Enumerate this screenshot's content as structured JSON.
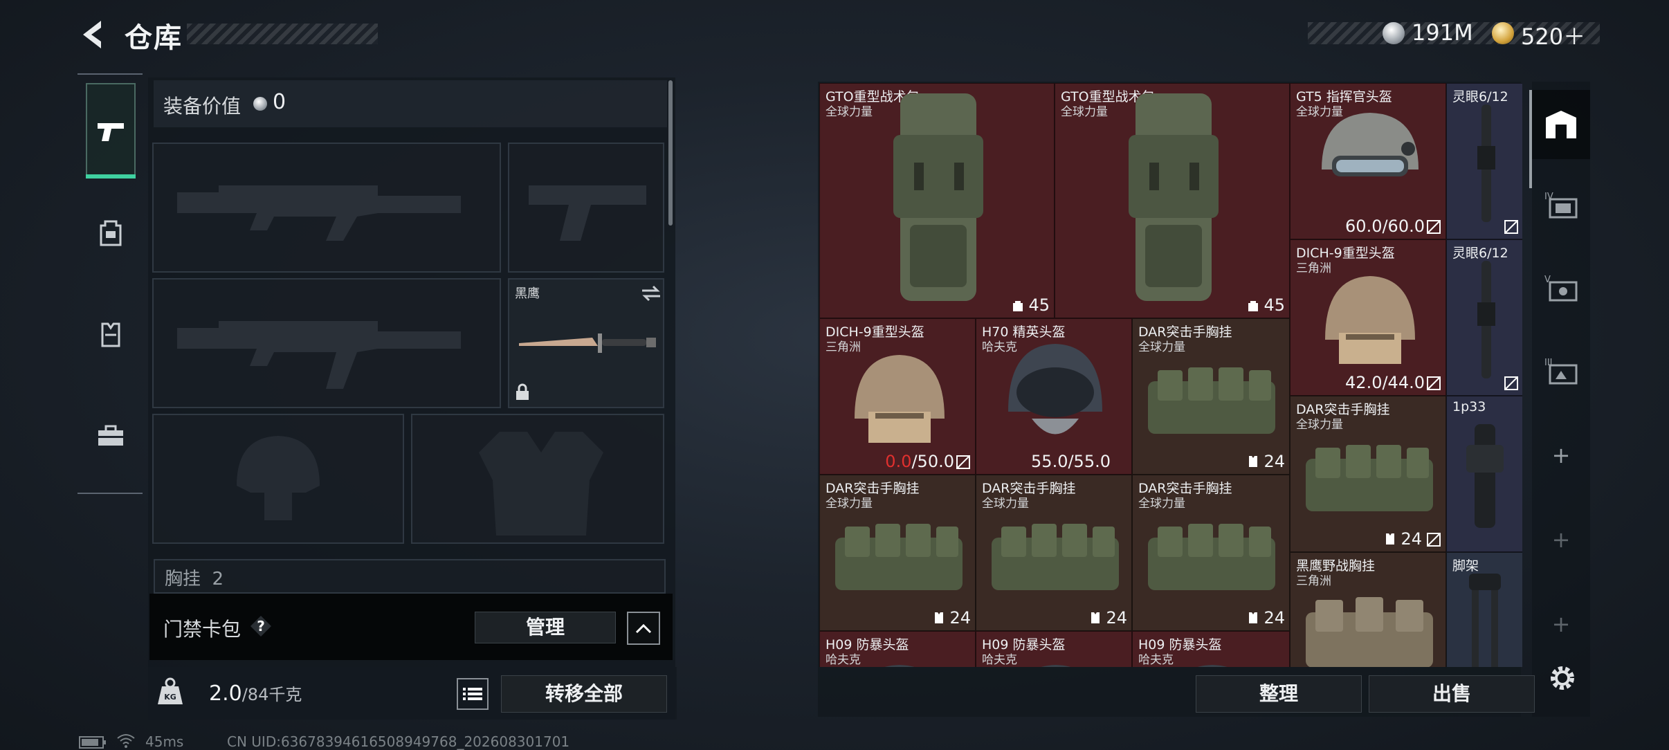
{
  "header": {
    "title": "仓库",
    "silver": "191M",
    "gold": "520＋"
  },
  "equipment": {
    "value_label": "装备价值",
    "value": "0",
    "knife_name": "黑鹰",
    "partial_label": "胸挂",
    "partial_count": "2",
    "keycard_label": "门禁卡包",
    "help": "?",
    "manage_label": "管理",
    "weight_current": "2.0",
    "weight_max": "/84千克",
    "transfer_label": "转移全部"
  },
  "status": {
    "ping": "45ms",
    "uid": "CN UID:636783946165089497​68_202608301701"
  },
  "stash": {
    "items": [
      {
        "name": "GTO重型战术包",
        "sub": "全球力量",
        "count": "45"
      },
      {
        "name": "GTO重型战术包",
        "sub": "全球力量",
        "count": "45"
      },
      {
        "name": "GT5 指挥官头盔",
        "sub": "全球力量",
        "dur": "60.0/60.0"
      },
      {
        "name": "灵眼6/12"
      },
      {
        "name": "DICH-9重型头盔",
        "sub": "三角洲",
        "dur": "42.0/44.0"
      },
      {
        "name": "灵眼6/12"
      },
      {
        "name": "DICH-9重型头盔",
        "sub": "三角洲",
        "dur_dmg": "0.0",
        "dur_rest": "/50.0"
      },
      {
        "name": "H70 精英头盔",
        "sub": "哈夫克",
        "dur": "55.0/55.0"
      },
      {
        "name": "DAR突击手胸挂",
        "sub": "全球力量",
        "count": "24"
      },
      {
        "name": "DAR突击手胸挂",
        "sub": "全球力量",
        "count": "24"
      },
      {
        "name": "1p33"
      },
      {
        "name": "DAR突击手胸挂",
        "sub": "全球力量",
        "count": "24"
      },
      {
        "name": "DAR突击手胸挂",
        "sub": "全球力量",
        "count": "24"
      },
      {
        "name": "DAR突击手胸挂",
        "sub": "全球力量",
        "count": "24"
      },
      {
        "name": "黑鹰野战胸挂",
        "sub": "三角洲"
      },
      {
        "name": "脚架"
      },
      {
        "name": "H09 防暴头盔",
        "sub": "哈夫克"
      },
      {
        "name": "H09 防暴头盔",
        "sub": "哈夫克"
      },
      {
        "name": "H09 防暴头盔",
        "sub": "哈夫克"
      }
    ]
  },
  "actions": {
    "sort_label": "整理",
    "sell_label": "出售"
  },
  "colors": {
    "accent": "#3fd1a0",
    "red_tier": "#4a1e22",
    "brown_tier": "#3a2a24",
    "blue_tier": "#2b2e44",
    "damaged": "#e0302e"
  },
  "icons": [
    "back-arrow-icon",
    "pistol-icon",
    "backpack-icon",
    "vest-icon",
    "toolbox-icon",
    "safe-icon",
    "weight-icon",
    "list-icon",
    "gear-icon"
  ]
}
